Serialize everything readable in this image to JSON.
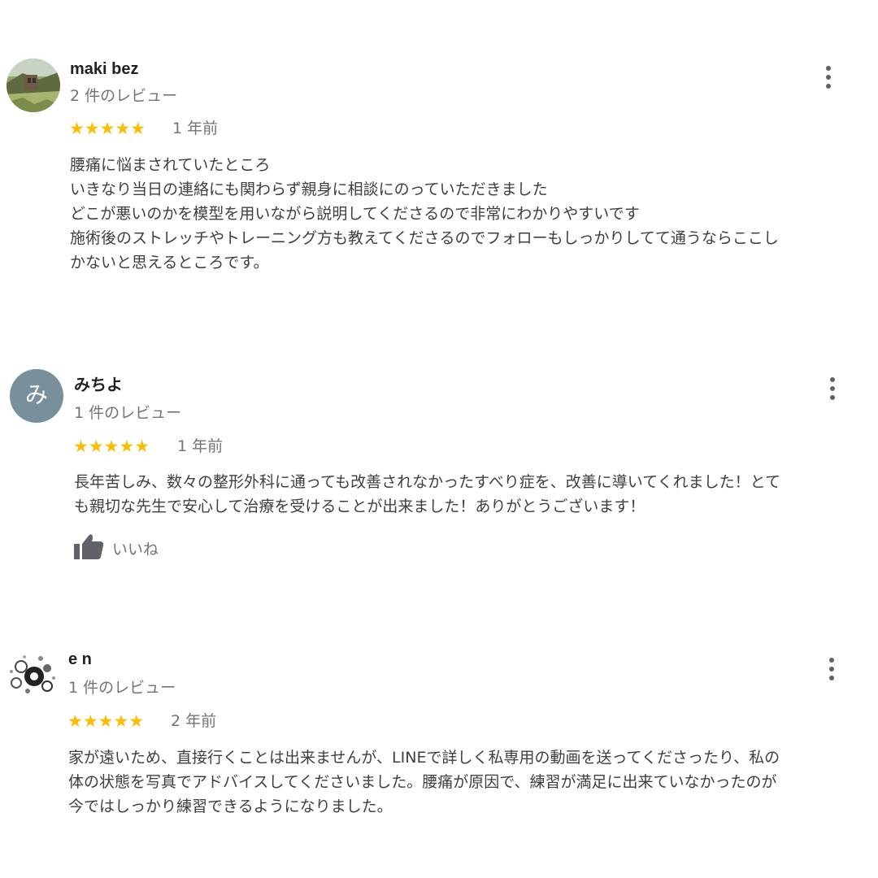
{
  "reviews": [
    {
      "name": "maki bez",
      "review_count": "2 件のレビュー",
      "stars": "★★★★★",
      "rating": 5,
      "age": "1 年前",
      "lines": [
        "腰痛に悩まされていたところ",
        "いきなり当日の連絡にも関わらず親身に相談にのっていただきました",
        "どこが悪いのかを模型を用いながら説明してくださるので非常にわかりやすいです",
        "施術後のストレッチやトレーニング方も教えてくださるのでフォローもしっかりしてて通うならここし",
        "かないと思えるところです。"
      ]
    },
    {
      "name": "みちよ",
      "avatar_letter": "み",
      "review_count": "1 件のレビュー",
      "stars": "★★★★★",
      "rating": 5,
      "age": "1 年前",
      "lines": [
        "長年苦しみ、数々の整形外科に通っても改善されなかったすべり症を、改善に導いてくれました！とて",
        "も親切な先生で安心して治療を受けることが出来ました！ありがとうございます！"
      ],
      "like_label": "いいね"
    },
    {
      "name": "e n",
      "review_count": "1 件のレビュー",
      "stars": "★★★★★",
      "rating": 5,
      "age": "2 年前",
      "lines": [
        "家が遠いため、直接行くことは出来ませんが、LINEで詳しく私専用の動画を送ってくださったり、私の",
        "体の状態を写真でアドバイスしてくださいました。腰痛が原因で、練習が満足に出来ていなかったのが",
        "今ではしっかり練習できるようになりました。"
      ]
    }
  ],
  "colors": {
    "star": "#fbbc04",
    "secondary_text": "#70757a",
    "avatar_letter_bg": "#78909c"
  },
  "icons": {
    "more": "more-vertical-icon",
    "like": "thumbs-up-icon"
  }
}
